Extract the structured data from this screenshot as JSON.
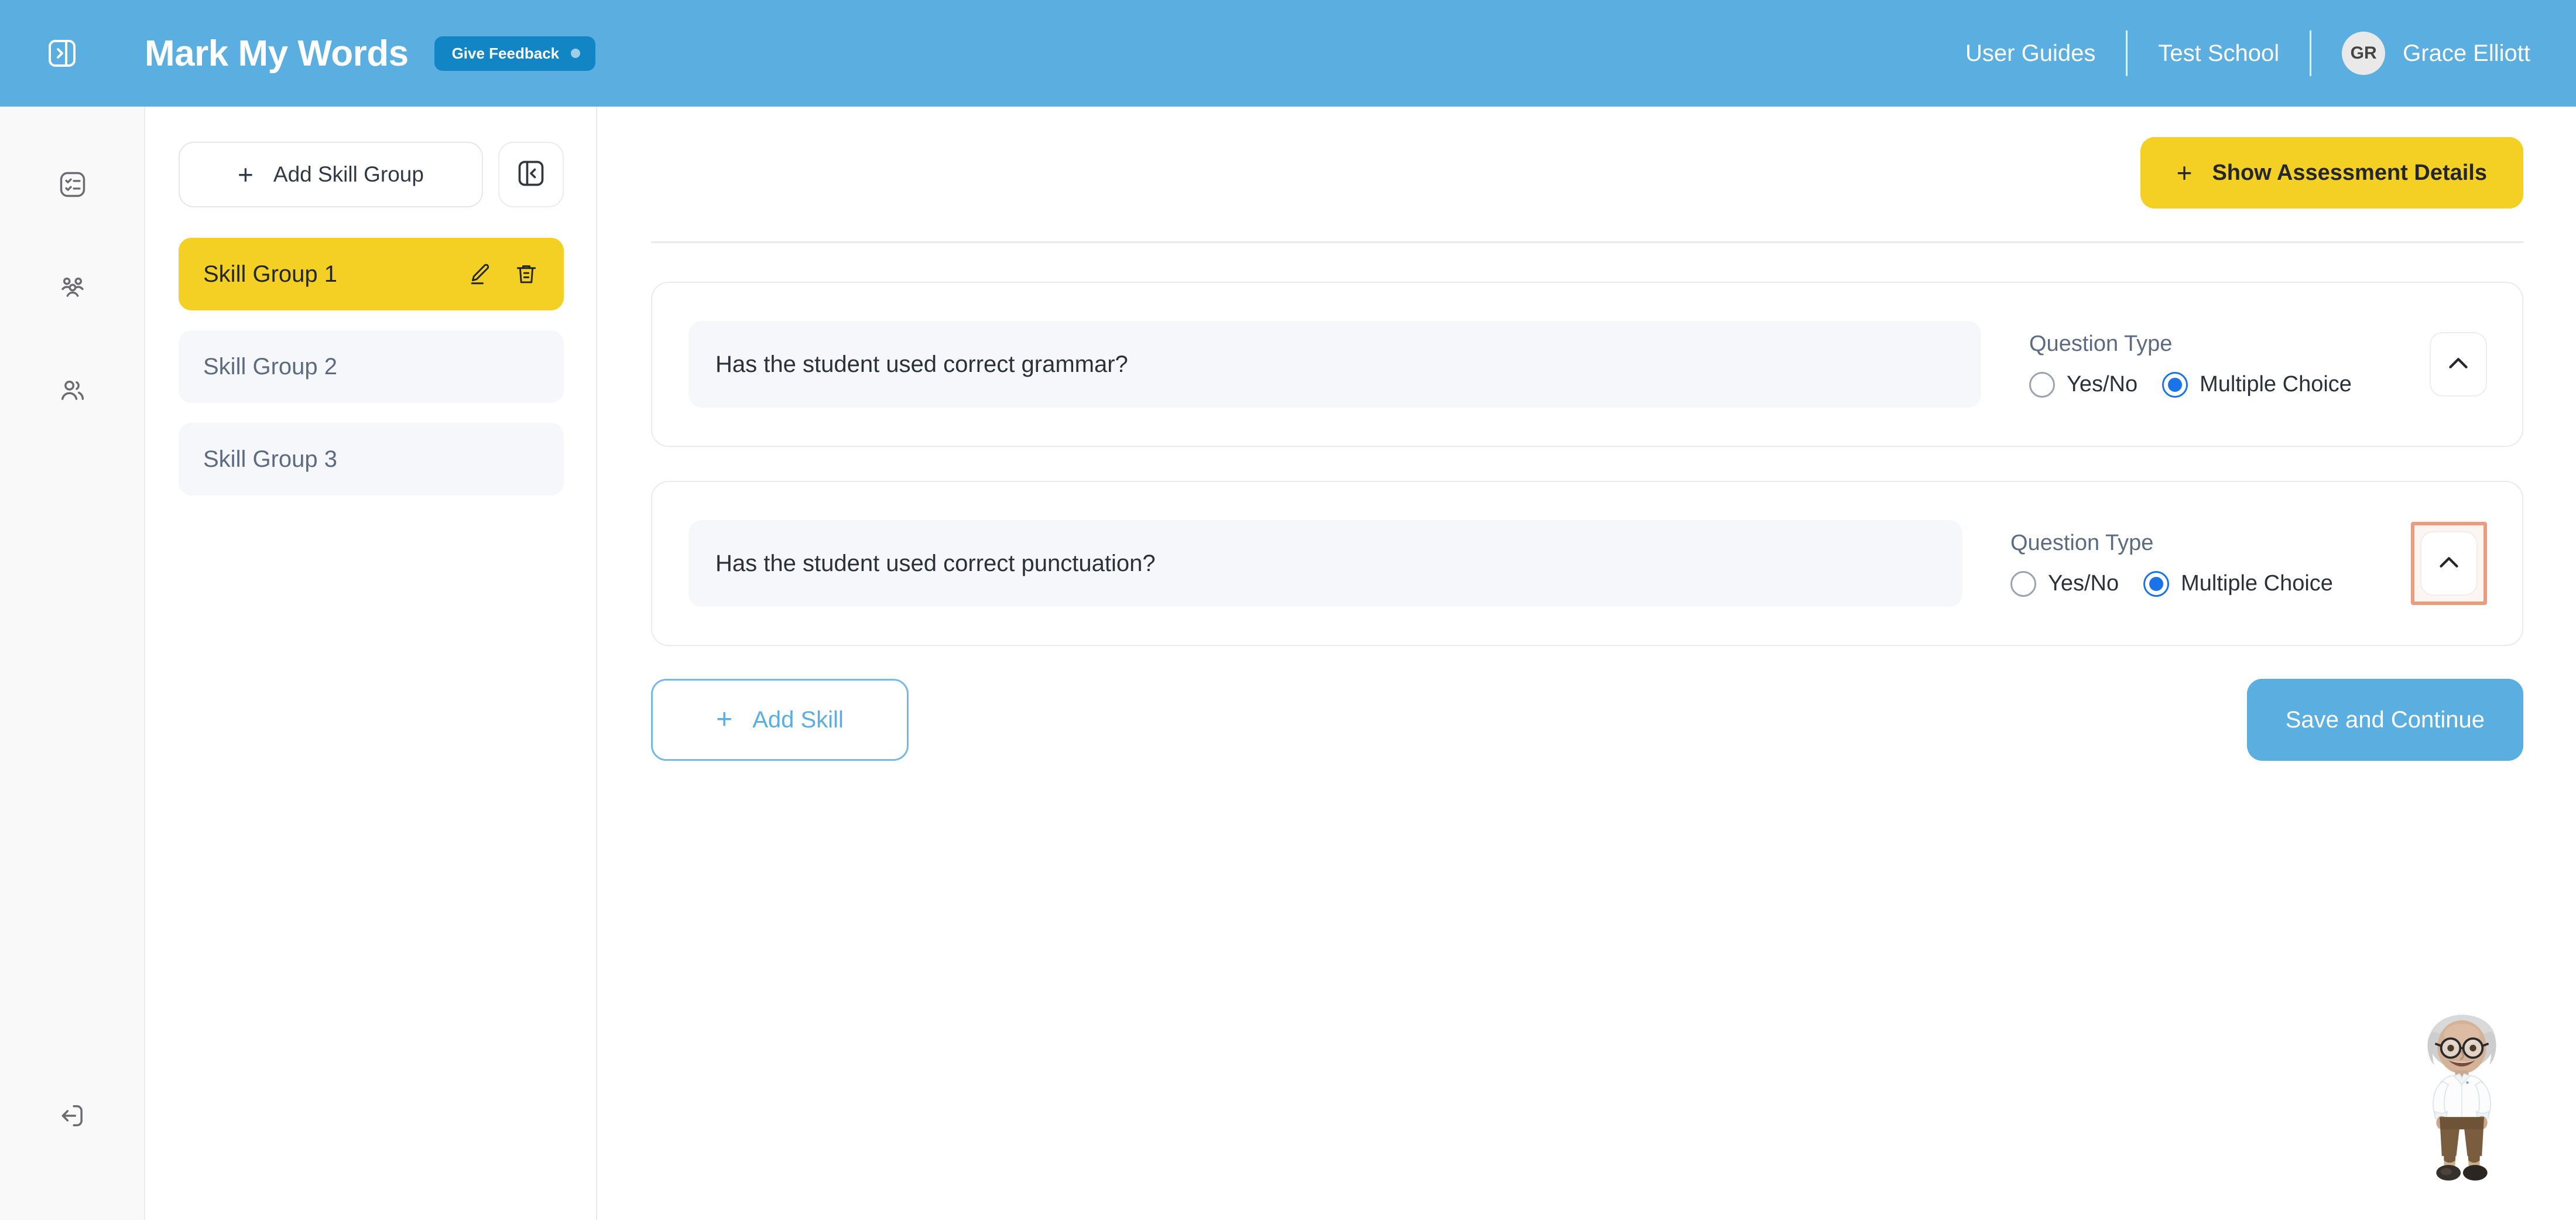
{
  "header": {
    "panel_toggle_icon": "panel-expand-icon",
    "app_title": "Mark My Words",
    "feedback_label": "Give Feedback",
    "links": [
      {
        "label": "User Guides"
      },
      {
        "label": "Test School"
      }
    ],
    "user": {
      "initials": "GR",
      "name": "Grace Elliott"
    }
  },
  "icon_rail": {
    "items": [
      {
        "name": "assessments-icon",
        "title": "Assessments"
      },
      {
        "name": "students-group-icon",
        "title": "Classes"
      },
      {
        "name": "users-icon",
        "title": "Users"
      },
      {
        "name": "logout-icon",
        "title": "Log out"
      }
    ]
  },
  "group_panel": {
    "add_group_label": "Add Skill Group",
    "add_group_plus": "+",
    "collapse_icon": "panel-collapse-icon",
    "groups": [
      {
        "label": "Skill Group 1",
        "active": true,
        "edit_icon": "pencil-icon",
        "delete_icon": "trash-icon"
      },
      {
        "label": "Skill Group 2",
        "active": false
      },
      {
        "label": "Skill Group 3",
        "active": false
      }
    ]
  },
  "main": {
    "show_details_label": "Show Assessment Details",
    "show_details_plus": "+",
    "question_type_label": "Question Type",
    "radio_options": [
      {
        "label": "Yes/No",
        "selected": false
      },
      {
        "label": "Multiple Choice",
        "selected": true
      }
    ],
    "skills": [
      {
        "question": "Has the student used correct grammar?",
        "type_label": "Question Type",
        "opt1": "Yes/No",
        "opt2": "Multiple Choice",
        "collapse_icon": "chevron-up-icon",
        "highlighted": false
      },
      {
        "question": "Has the student used correct punctuation?",
        "type_label": "Question Type",
        "opt1": "Yes/No",
        "opt2": "Multiple Choice",
        "collapse_icon": "chevron-up-icon",
        "highlighted": true
      }
    ],
    "add_skill_label": "Add Skill",
    "add_skill_plus": "+",
    "save_label": "Save and Continue"
  },
  "mascot": {
    "name": "teacher-mascot"
  },
  "colors": {
    "header_blue": "#5BAEE0",
    "accent_yellow": "#F5D024",
    "feedback_blue": "#1286C4",
    "radio_selected": "#1A73E8",
    "highlight_outline": "#EC9C7E",
    "panel_bg": "#F6F7FB"
  }
}
